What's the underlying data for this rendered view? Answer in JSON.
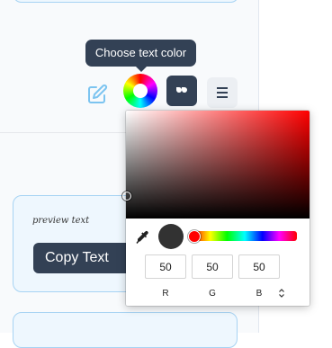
{
  "tooltip": {
    "text": "Choose text color"
  },
  "toolbar": {
    "icons": [
      "edit-icon",
      "color-wheel-icon",
      "quote-icon",
      "menu-icon"
    ],
    "accent_color": "#334155"
  },
  "preview": {
    "text": "preview text",
    "copy_button_label": "Copy Text",
    "copy_icon": "clipboard-icon"
  },
  "color_picker": {
    "hue_color": "#ff0000",
    "current_color": "#323232",
    "rgb": {
      "r": "50",
      "g": "50",
      "b": "50"
    },
    "labels": {
      "r": "R",
      "g": "G",
      "b": "B"
    },
    "icons": [
      "eyedropper-icon",
      "toggle-mode-icon"
    ]
  }
}
